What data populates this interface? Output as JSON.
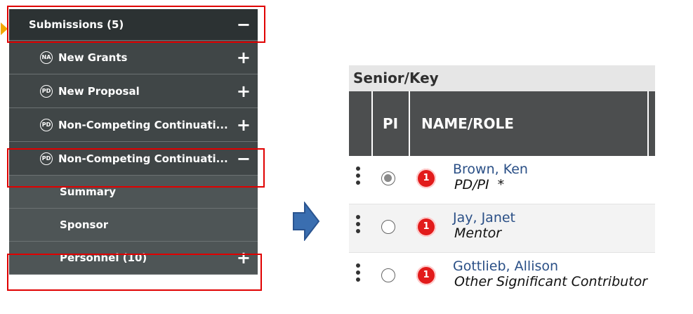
{
  "nav": {
    "items": [
      {
        "label": "Submissions (5)",
        "toggle": "−"
      },
      {
        "label": "New Grants",
        "icon": "NA",
        "toggle": "+"
      },
      {
        "label": "New Proposal",
        "icon": "PD",
        "toggle": "+"
      },
      {
        "label": "Non-Competing Continuati...",
        "icon": "PD",
        "toggle": "+"
      },
      {
        "label": "Non-Competing Continuati...",
        "icon": "PD",
        "toggle": "−"
      },
      {
        "label": "Summary"
      },
      {
        "label": "Sponsor"
      },
      {
        "label": "Personnel (10)",
        "toggle": "+"
      }
    ]
  },
  "senior_key": {
    "title": "Senior/Key",
    "columns": {
      "pi": "PI",
      "name_role": "NAME/ROLE"
    },
    "rows": [
      {
        "name": "Brown, Ken",
        "role": "PD/PI  *",
        "badge": "1",
        "pi_selected": true
      },
      {
        "name": "Jay, Janet",
        "role": "Mentor",
        "badge": "1",
        "pi_selected": false
      },
      {
        "name": "Gottlieb, Allison",
        "role": "Other Significant Contributor",
        "badge": "1",
        "pi_selected": false
      }
    ]
  },
  "colors": {
    "highlight": "#e00000",
    "caret": "#f2a900",
    "arrow": "#3a6eb0",
    "badge": "#e21b1b",
    "link": "#2a4f86"
  }
}
